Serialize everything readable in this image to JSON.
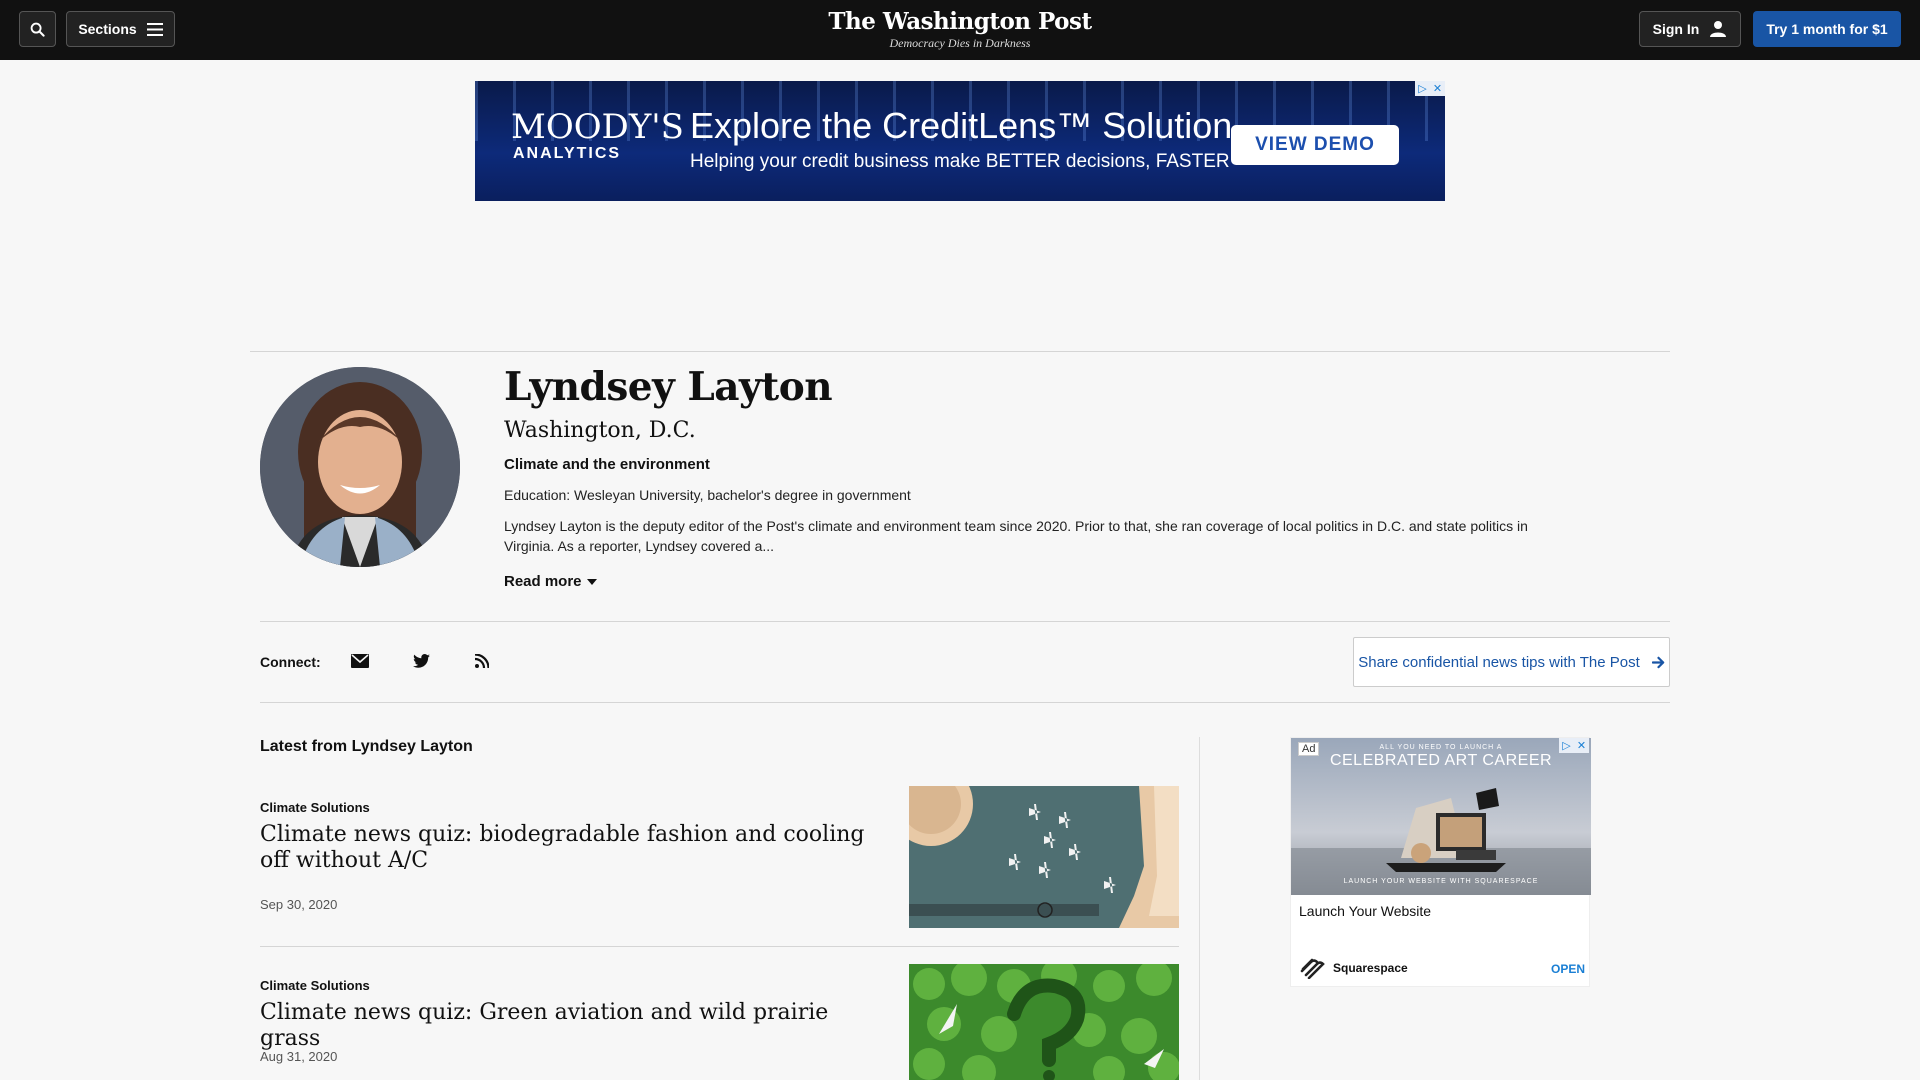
{
  "header": {
    "sections_label": "Sections",
    "logo_title": "The Washington Post",
    "logo_tagline": "Democracy Dies in Darkness",
    "signin_label": "Sign In",
    "subscribe_label": "Try 1 month for $1"
  },
  "top_ad": {
    "brand": "MOODY'S",
    "brand_sub": "ANALYTICS",
    "headline": "Explore the CreditLens™ Solution",
    "subline": "Helping your credit business make BETTER decisions, FASTER",
    "cta": "VIEW DEMO"
  },
  "profile": {
    "name": "Lyndsey Layton",
    "location": "Washington, D.C.",
    "beat": "Climate and the environment",
    "education": "Education: Wesleyan University, bachelor's degree in government",
    "bio": "Lyndsey Layton is the deputy editor of the Post's climate and environment team since 2020. Prior to that, she ran coverage of local politics in D.C. and state politics in Virginia. As a reporter, Lyndsey covered a...",
    "read_more": "Read more"
  },
  "connect": {
    "label": "Connect:",
    "tips_label": "Share confidential news tips with The Post"
  },
  "latest": {
    "heading": "Latest from Lyndsey Layton",
    "articles": [
      {
        "kicker": "Climate Solutions",
        "headline": "Climate news quiz: biodegradable fashion and cooling off without A/C",
        "date": "Sep 30, 2020"
      },
      {
        "kicker": "Climate Solutions",
        "headline": "Climate news quiz: Green aviation and wild prairie grass",
        "date": "Aug 31, 2020"
      }
    ]
  },
  "side_ad": {
    "ad_label": "Ad",
    "top_text": "ALL YOU NEED TO LAUNCH A",
    "title": "CELEBRATED ART CAREER",
    "bottom_text": "LAUNCH YOUR WEBSITE WITH SQUARESPACE",
    "caption": "Launch Your Website",
    "brand": "Squarespace",
    "cta": "OPEN"
  },
  "colors": {
    "topbar_bg": "#111111",
    "subscribe_bg": "#1955a5",
    "link_blue": "#1955a5"
  }
}
